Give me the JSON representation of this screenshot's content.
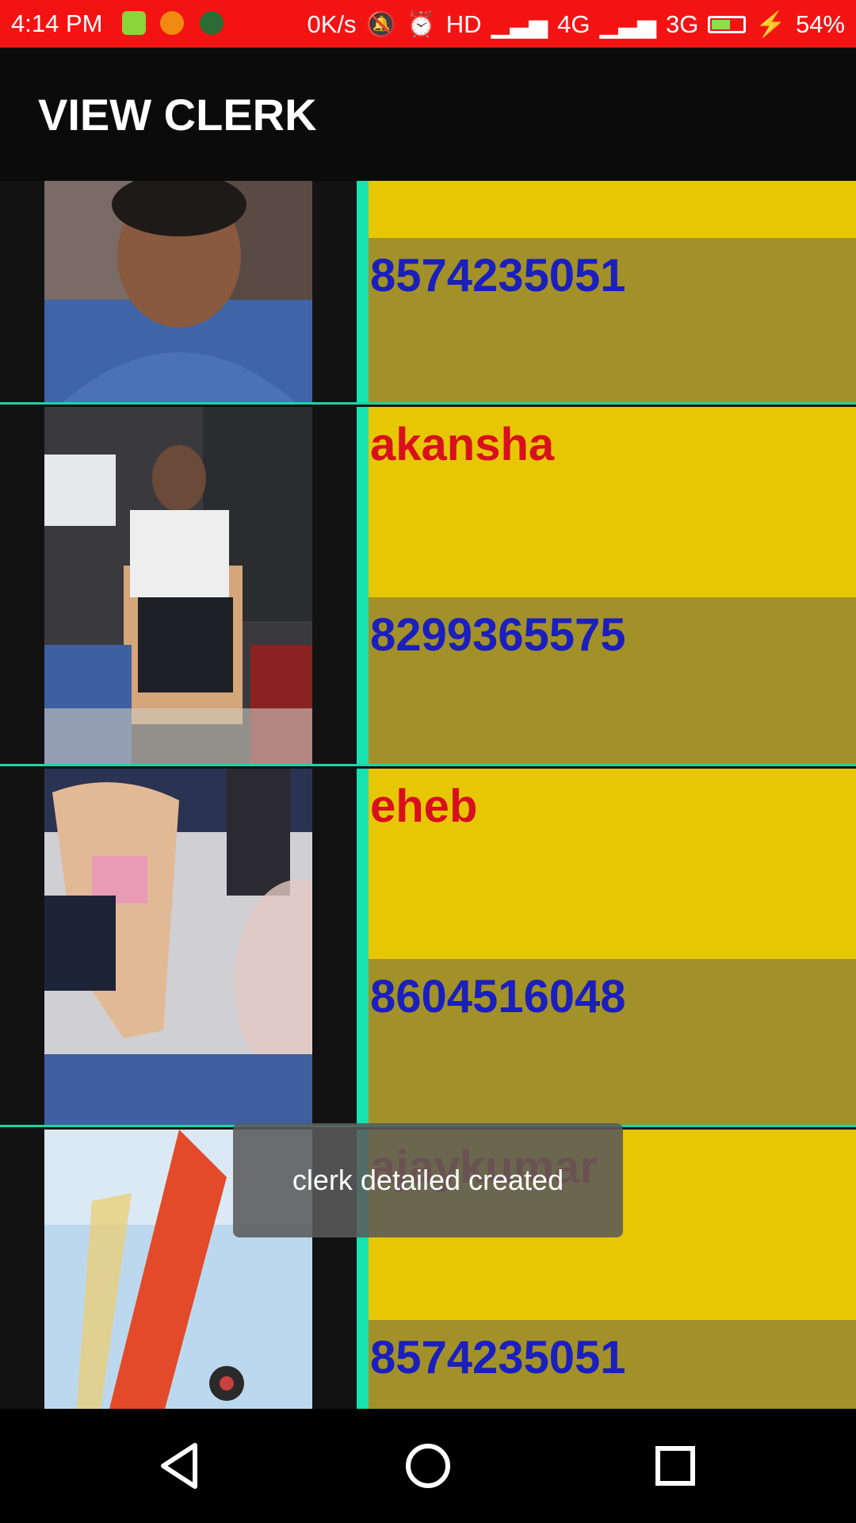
{
  "status_bar": {
    "time": "4:14 PM",
    "net_speed": "0K/s",
    "hd": "HD",
    "net1": "4G",
    "net2": "3G",
    "battery_level": 0.54,
    "battery_text": "54%",
    "icons": [
      "notification-app-icon",
      "notification-app-icon-2",
      "call-icon",
      "mute-icon",
      "alarm-icon",
      "signal-icon",
      "battery-icon",
      "charging-icon"
    ]
  },
  "app_bar": {
    "title": "VIEW CLERK"
  },
  "clerks": [
    {
      "name": "",
      "phone": "8574235051"
    },
    {
      "name": "akansha",
      "phone": "8299365575"
    },
    {
      "name": "eheb",
      "phone": "8604516048"
    },
    {
      "name": "ajaykumar",
      "phone": "8574235051"
    }
  ],
  "toast": {
    "message": "clerk detailed created"
  },
  "nav_bar": {
    "icons": [
      "back-icon",
      "home-icon",
      "recents-icon"
    ]
  },
  "colors": {
    "status_bar": "#f41313",
    "name_cell": "#e7c704",
    "phone_cell": "#a29128",
    "divider": "#16e3b0",
    "name_text": "#d8101d",
    "phone_text": "#1a1fbd"
  }
}
